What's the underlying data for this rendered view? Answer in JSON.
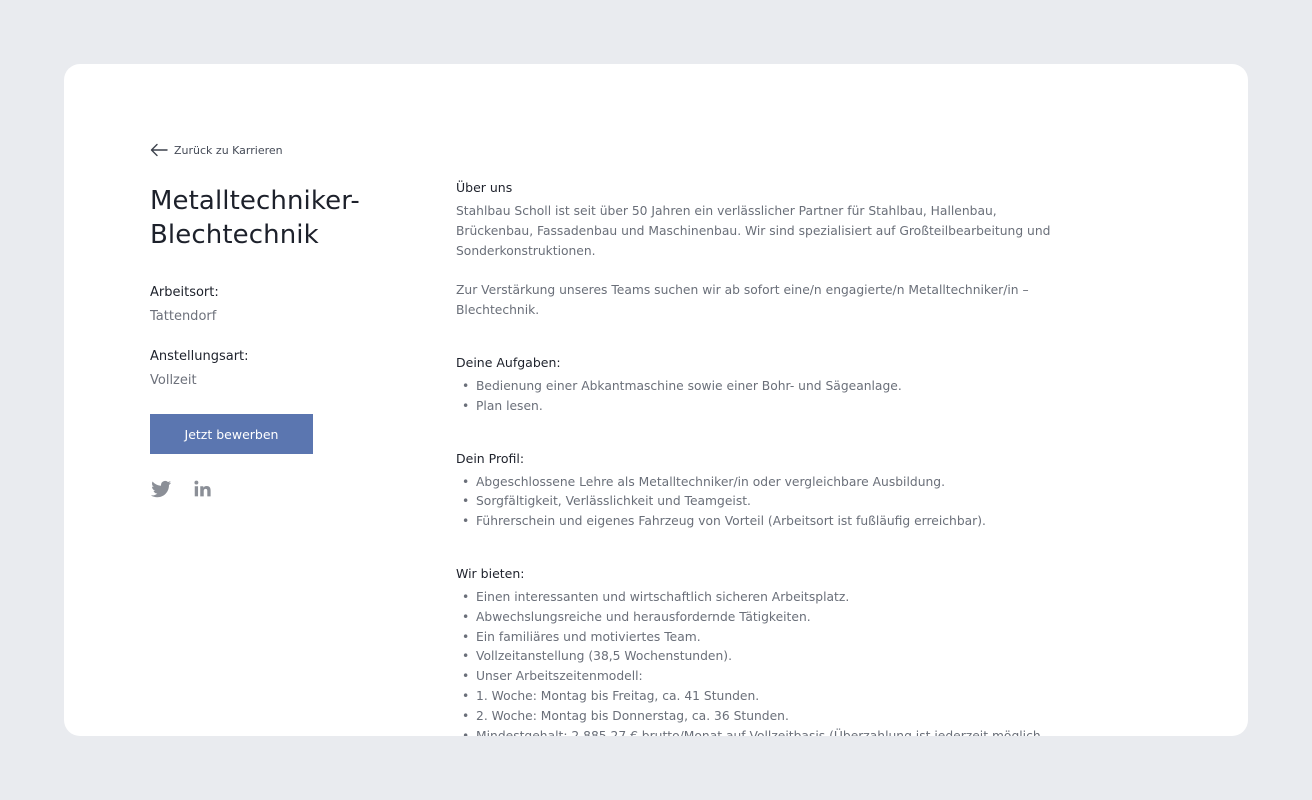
{
  "back_link": {
    "label": "Zurück zu Karrieren",
    "icon": "arrow-left-icon"
  },
  "job": {
    "title": "Metalltechniker-Blechtechnik",
    "location_label": "Arbeitsort:",
    "location_value": "Tattendorf",
    "employment_label": "Anstellungsart:",
    "employment_value": "Vollzeit",
    "apply_label": "Jetzt bewerben"
  },
  "social": [
    {
      "icon": "twitter-icon"
    },
    {
      "icon": "linkedin-icon"
    }
  ],
  "colors": {
    "accent": "#5b76b0",
    "background": "#e9ebef",
    "card": "#ffffff",
    "muted_text": "#6a6f79",
    "icon": "#8b8f97"
  },
  "about": {
    "heading": "Über uns",
    "paragraphs": [
      "Stahlbau Scholl ist seit über 50 Jahren ein verlässlicher Partner für Stahlbau, Hallenbau, Brückenbau, Fassadenbau und Maschinenbau. Wir sind spezialisiert auf Großteilbearbeitung und Sonderkonstruktionen.",
      "Zur Verstärkung unseres Teams suchen wir ab sofort eine/n engagierte/n Metalltechniker/in – Blechtechnik."
    ]
  },
  "tasks": {
    "heading": "Deine Aufgaben:",
    "items": [
      "Bedienung einer Abkantmaschine sowie einer Bohr- und Sägeanlage.",
      "Plan lesen."
    ]
  },
  "profile": {
    "heading": "Dein Profil:",
    "items": [
      "Abgeschlossene Lehre als Metalltechniker/in oder vergleichbare Ausbildung.",
      "Sorgfältigkeit, Verlässlichkeit und Teamgeist.",
      "Führerschein und eigenes Fahrzeug von Vorteil (Arbeitsort ist fußläufig erreichbar)."
    ]
  },
  "offer": {
    "heading": "Wir bieten:",
    "items": [
      "Einen interessanten und wirtschaftlich sicheren Arbeitsplatz.",
      "Abwechslungsreiche und herausfordernde Tätigkeiten.",
      "Ein familiäres und motiviertes Team.",
      "Vollzeitanstellung (38,5 Wochenstunden).",
      "Unser Arbeitszeitenmodell:",
      "1. Woche: Montag bis Freitag, ca. 41 Stunden.",
      "2. Woche: Montag bis Donnerstag, ca. 36 Stunden.",
      "Mindestgehalt: 2.885,27 € brutto/Monat auf Vollzeitbasis (Überzahlung ist jederzeit möglich"
    ]
  }
}
